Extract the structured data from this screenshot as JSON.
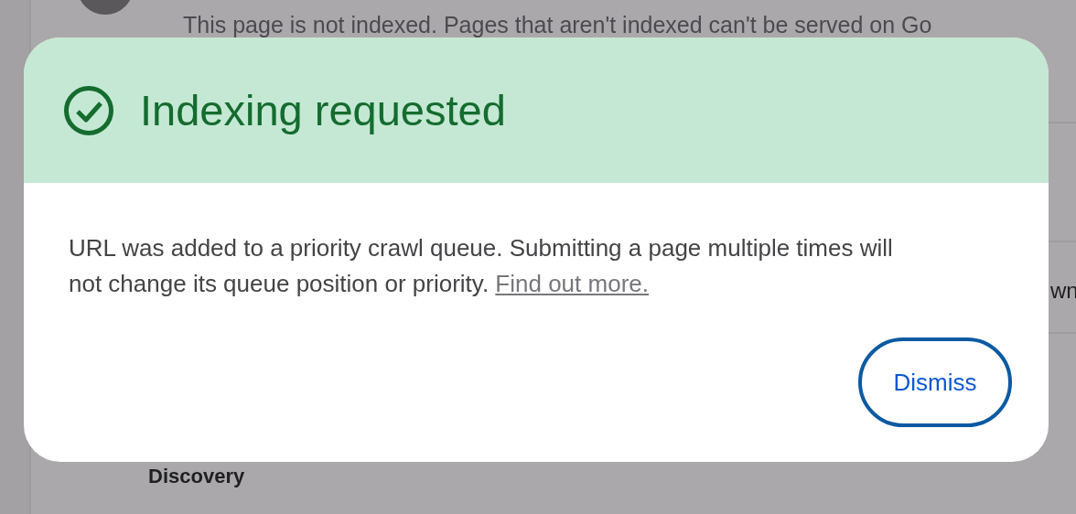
{
  "background": {
    "notice": "This page is not indexed. Pages that aren't indexed can't be served on Go",
    "right_text": "wn",
    "section": "Discovery"
  },
  "dialog": {
    "title": "Indexing requested",
    "message": "URL was added to a priority crawl queue. Submitting a page multiple times will not change its queue position or priority.",
    "link": "Find out more.",
    "button": "Dismiss"
  }
}
